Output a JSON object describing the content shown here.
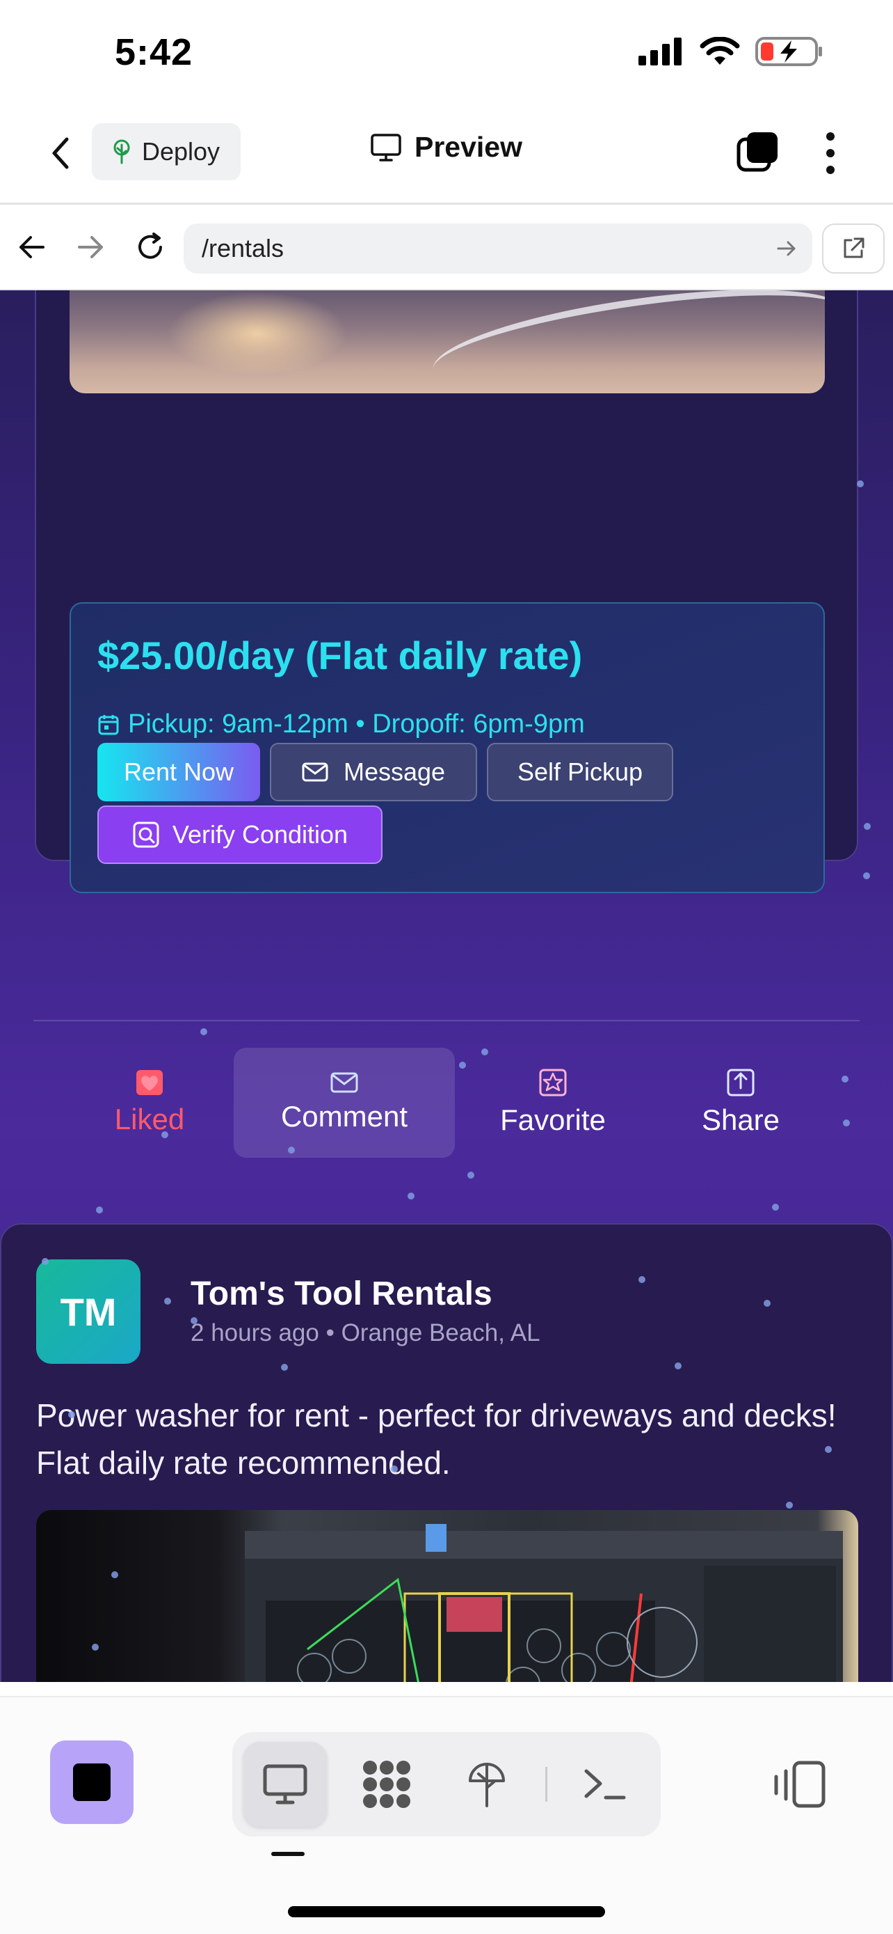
{
  "status_bar": {
    "time": "5:42"
  },
  "header": {
    "deploy_label": "Deploy",
    "title": "Preview"
  },
  "address_bar": {
    "url": "/rentals"
  },
  "listing": {
    "price_title": "$25.00/day (Flat daily rate)",
    "pickup_info": "Pickup: 9am-12pm • Dropoff: 6pm-9pm",
    "buttons": {
      "rent_now": "Rent Now",
      "message": "Message",
      "self_pickup": "Self Pickup",
      "verify_condition": "Verify Condition"
    }
  },
  "actions": {
    "liked": "Liked",
    "comment": "Comment",
    "favorite": "Favorite",
    "share": "Share"
  },
  "post": {
    "avatar_initials": "TM",
    "author": "Tom's Tool Rentals",
    "meta": "2 hours ago • Orange Beach, AL",
    "text": "Power washer for rent - perfect for driveways and decks! Flat daily rate recommended."
  },
  "colors": {
    "accent_cyan": "#2ce0ef",
    "liked_red": "#ff5a6b",
    "verify_purple": "#8a3ff0",
    "stop_button": "#b7a4f8"
  },
  "icons": {
    "deploy": "tree-icon",
    "preview": "monitor-icon",
    "pickup": "calendar-icon",
    "message": "envelope-icon",
    "verify": "magnify-square-icon",
    "liked": "heart-icon",
    "comment": "envelope-icon",
    "favorite": "star-icon",
    "share": "share-icon"
  }
}
